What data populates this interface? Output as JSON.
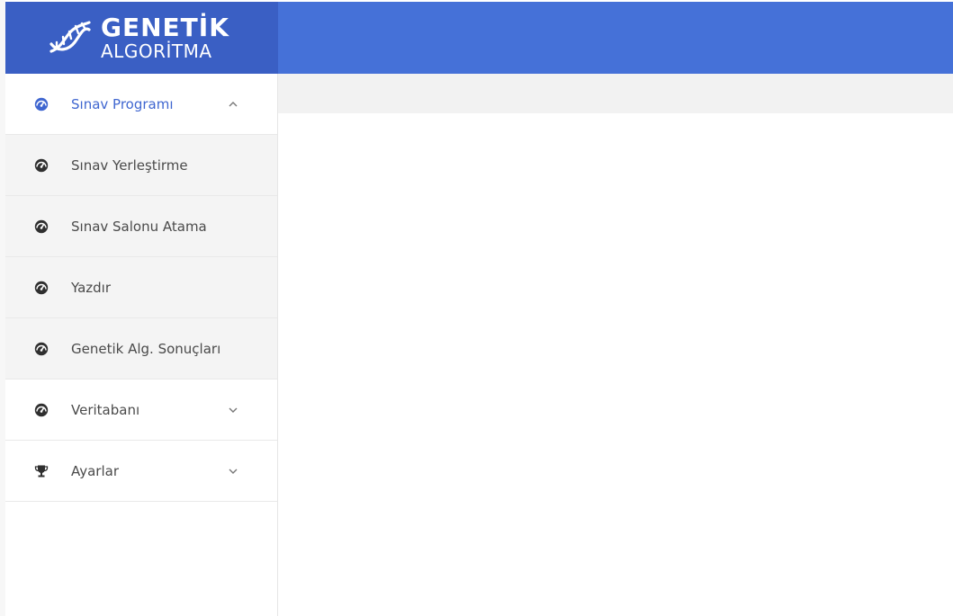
{
  "brand": {
    "title": "GENETİK",
    "subtitle": "ALGORİTMA",
    "logo_icon": "dna-icon"
  },
  "colors": {
    "logo_bg": "#3a5fc4",
    "topbar_bg": "#4571d8",
    "active_text": "#3f66d0",
    "sub_bg": "#f4f4f4"
  },
  "sidebar": {
    "items": [
      {
        "label": "Sınav Programı",
        "icon": "dashboard-icon",
        "chevron": "chevron-up-icon",
        "active": true
      },
      {
        "label": "Sınav Yerleştirme",
        "icon": "dashboard-icon"
      },
      {
        "label": "Sınav Salonu Atama",
        "icon": "dashboard-icon"
      },
      {
        "label": "Yazdır",
        "icon": "dashboard-icon"
      },
      {
        "label": "Genetik Alg. Sonuçları",
        "icon": "dashboard-icon"
      },
      {
        "label": "Veritabanı",
        "icon": "dashboard-icon",
        "chevron": "chevron-down-icon"
      },
      {
        "label": "Ayarlar",
        "icon": "trophy-icon",
        "chevron": "chevron-down-icon"
      }
    ]
  }
}
